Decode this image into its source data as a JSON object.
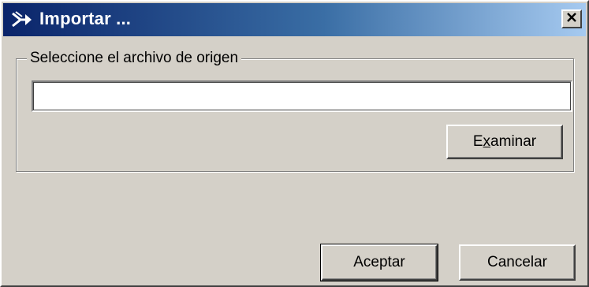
{
  "window": {
    "title": "Importar ...",
    "app_icon": "import-arrow-icon",
    "close_icon": "close-icon"
  },
  "source_group": {
    "legend": "Seleccione el archivo de origen",
    "path_value": "",
    "browse_before": "E",
    "browse_mnemonic": "x",
    "browse_after": "aminar"
  },
  "footer": {
    "accept_label": "Aceptar",
    "cancel_label": "Cancelar"
  },
  "colors": {
    "face": "#d4d0c8",
    "title_start": "#0a246a",
    "title_end": "#a6caf0"
  }
}
